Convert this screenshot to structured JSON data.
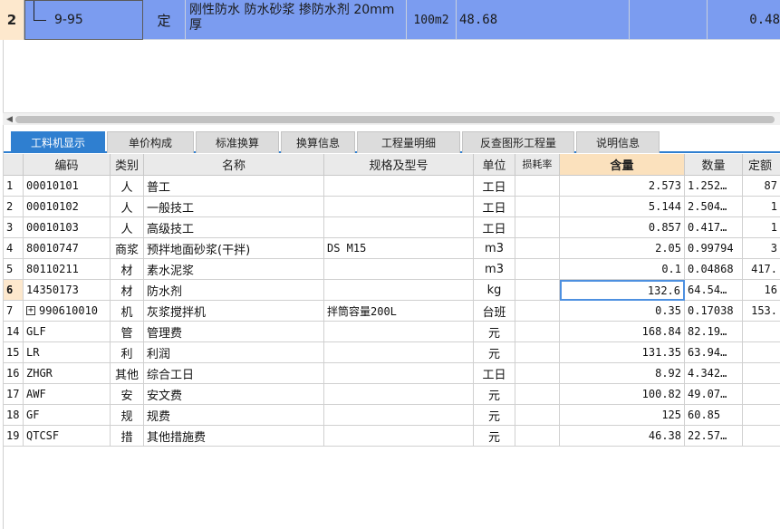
{
  "top_row": {
    "index": "2",
    "code": "9-95",
    "type": "定",
    "name": "刚性防水 防水砂浆 掺防水剂 20mm厚",
    "unit": "100m2",
    "quantity": "48.68",
    "extra1": "",
    "extra2": "0.48"
  },
  "tabs": [
    {
      "label": "工料机显示",
      "active": true
    },
    {
      "label": "单价构成",
      "active": false
    },
    {
      "label": "标准换算",
      "active": false
    },
    {
      "label": "换算信息",
      "active": false
    },
    {
      "label": "工程量明细",
      "active": false
    },
    {
      "label": "反查图形工程量",
      "active": false
    },
    {
      "label": "说明信息",
      "active": false
    }
  ],
  "grid": {
    "headers": [
      "",
      "编码",
      "类别",
      "名称",
      "规格及型号",
      "单位",
      "损耗率",
      "含量",
      "数量",
      "定额"
    ],
    "rows": [
      {
        "no": "1",
        "code": "00010101",
        "cat": "人",
        "name": "普工",
        "spec": "",
        "unit": "工日",
        "loss": "",
        "content": "2.573",
        "qty": "1.252…",
        "quota": "87"
      },
      {
        "no": "2",
        "code": "00010102",
        "cat": "人",
        "name": "一般技工",
        "spec": "",
        "unit": "工日",
        "loss": "",
        "content": "5.144",
        "qty": "2.504…",
        "quota": "1"
      },
      {
        "no": "3",
        "code": "00010103",
        "cat": "人",
        "name": "高级技工",
        "spec": "",
        "unit": "工日",
        "loss": "",
        "content": "0.857",
        "qty": "0.417…",
        "quota": "1"
      },
      {
        "no": "4",
        "code": "80010747",
        "cat": "商浆",
        "name": "预拌地面砂浆(干拌)",
        "spec": "DS M15",
        "unit": "m3",
        "loss": "",
        "content": "2.05",
        "qty": "0.99794",
        "quota": "3"
      },
      {
        "no": "5",
        "code": "80110211",
        "cat": "材",
        "name": "素水泥浆",
        "spec": "",
        "unit": "m3",
        "loss": "",
        "content": "0.1",
        "qty": "0.04868",
        "quota": "417."
      },
      {
        "no": "6",
        "code": "14350173",
        "cat": "材",
        "name": "防水剂",
        "spec": "",
        "unit": "kg",
        "loss": "",
        "content": "132.6",
        "qty": "64.54…",
        "quota": "16"
      },
      {
        "no": "7",
        "code": "990610010",
        "cat": "机",
        "name": "灰浆搅拌机",
        "spec": "拌筒容量200L",
        "unit": "台班",
        "loss": "",
        "content": "0.35",
        "qty": "0.17038",
        "quota": "153."
      },
      {
        "no": "14",
        "code": "GLF",
        "cat": "管",
        "name": "管理费",
        "spec": "",
        "unit": "元",
        "loss": "",
        "content": "168.84",
        "qty": "82.19…",
        "quota": ""
      },
      {
        "no": "15",
        "code": "LR",
        "cat": "利",
        "name": "利润",
        "spec": "",
        "unit": "元",
        "loss": "",
        "content": "131.35",
        "qty": "63.94…",
        "quota": ""
      },
      {
        "no": "16",
        "code": "ZHGR",
        "cat": "其他",
        "name": "综合工日",
        "spec": "",
        "unit": "工日",
        "loss": "",
        "content": "8.92",
        "qty": "4.342…",
        "quota": ""
      },
      {
        "no": "17",
        "code": "AWF",
        "cat": "安",
        "name": "安文费",
        "spec": "",
        "unit": "元",
        "loss": "",
        "content": "100.82",
        "qty": "49.07…",
        "quota": ""
      },
      {
        "no": "18",
        "code": "GF",
        "cat": "规",
        "name": "规费",
        "spec": "",
        "unit": "元",
        "loss": "",
        "content": "125",
        "qty": "60.85",
        "quota": ""
      },
      {
        "no": "19",
        "code": "QTCSF",
        "cat": "措",
        "name": "其他措施费",
        "spec": "",
        "unit": "元",
        "loss": "",
        "content": "46.38",
        "qty": "22.57…",
        "quota": ""
      }
    ]
  },
  "colors": {
    "selected_row": "#7b9cf0",
    "active_tab": "#2f7fd0",
    "highlight_header": "#fbe1bd",
    "row_marker": "#fde8cd"
  }
}
